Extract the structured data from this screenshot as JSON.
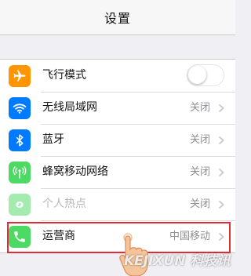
{
  "navbar": {
    "title": "设置"
  },
  "settings": [
    {
      "label": "飞行模式",
      "icon": "airplane-icon",
      "color": "#ff9500",
      "control": "toggle",
      "toggle_on": false
    },
    {
      "label": "无线局域网",
      "icon": "wifi-icon",
      "color": "#007aff",
      "value": "关闭"
    },
    {
      "label": "蓝牙",
      "icon": "bluetooth-icon",
      "color": "#007aff",
      "value": "关闭"
    },
    {
      "label": "蜂窝移动网络",
      "icon": "cellular-antenna-icon",
      "color": "#4cd964",
      "value": "关闭"
    },
    {
      "label": "个人热点",
      "icon": "personal-hotspot-icon",
      "color": "#4cd964",
      "value": "关闭",
      "dimmed": true
    },
    {
      "label": "运营商",
      "icon": "phone-icon",
      "color": "#4cd964",
      "value": "中国移动",
      "highlighted": true
    }
  ],
  "watermark": {
    "text": "KEJIXUN 科技讯"
  },
  "colors": {
    "highlight": "#e22b32",
    "background": "#efeff4",
    "chevron": "#c7c7cc"
  }
}
